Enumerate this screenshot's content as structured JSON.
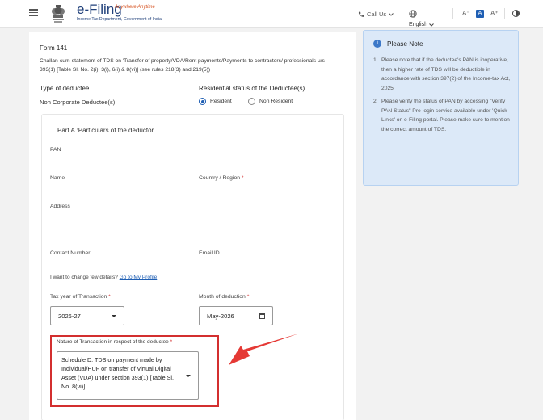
{
  "header": {
    "logo_title": "e-Filing",
    "logo_tagline": "Anywhere Anytime",
    "logo_subtitle": "Income Tax Department, Government of India",
    "call_us": "Call Us",
    "language": "English",
    "font_smaller": "A⁻",
    "font_normal": "A",
    "font_larger": "A⁺"
  },
  "form": {
    "title": "Form 141",
    "description": "Challan-cum-statement of TDS on 'Transfer of property/VDA/Rent payments/Payments to contractors/ professionals u/s 393(1) [Table Sl. No. 2(i), 3(i), 6(i) & 8(vi)] (see rules 218(3) and 219(5))",
    "deductee_type_label": "Type of deductee",
    "deductee_type_value": "Non Corporate Deductee(s)",
    "residential_label": "Residential status of the Deductee(s)",
    "residential_options": [
      "Resident",
      "Non Resident"
    ],
    "residential_selected": "Resident",
    "part_a_title": "Part A :Particulars of the deductor",
    "pan_label": "PAN",
    "name_label": "Name",
    "country_label": "Country / Region",
    "address_label": "Address",
    "contact_label": "Contact Number",
    "email_label": "Email ID",
    "change_text": "I want to change few details?",
    "change_link": "Go to My Profile",
    "tax_year_label": "Tax year of Transaction",
    "tax_year_value": "2026-27",
    "month_label": "Month of deduction",
    "month_value": "May-2026",
    "nature_label": "Nature of Transaction in respect of the deductee",
    "nature_value": "Schedule D: TDS on payment made by Individual/HUF on transfer of Virtual Digital Asset (VDA) under section 393(1) [Table Sl. No. 8(vi)]",
    "required_mark": "*"
  },
  "note": {
    "title": "Please Note",
    "items": [
      {
        "num": "1.",
        "text": "Please note that if the deductee's PAN is inoperative, then a higher rate of TDS will be deductible in accordance with section 397(2) of the Income-tax Act, 2025"
      },
      {
        "num": "2.",
        "text": "Please verify the status of PAN by accessing \"Verify PAN Status\" Pre-login service available under 'Quick Links' on e-Filing portal. Please make sure to mention the correct amount of TDS."
      }
    ]
  },
  "colors": {
    "accent": "#1f5fb4",
    "highlight_box": "#d32f2f",
    "annotation_arrow": "#e53935",
    "note_bg": "#dce9f8"
  },
  "icons": [
    "menu-icon",
    "emblem-icon",
    "phone-icon",
    "globe-icon",
    "chevron-down-icon",
    "contrast-icon",
    "info-icon",
    "calendar-icon",
    "arrow-annotation-icon"
  ]
}
